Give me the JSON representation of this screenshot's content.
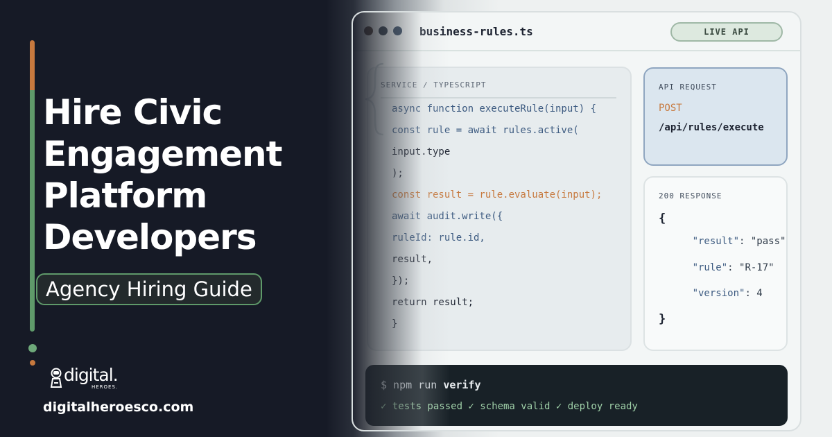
{
  "hero": {
    "title_lines": [
      "Hire Civic",
      "Engagement",
      "Platform",
      "Developers"
    ],
    "subtitle": "Agency Hiring Guide"
  },
  "brand": {
    "logo_word": "digital.",
    "logo_sub": "HEROES.",
    "url": "digitalheroesco.com"
  },
  "editor": {
    "filename": "business-rules.ts",
    "live_badge": "LIVE API",
    "code_header": "SERVICE / TYPESCRIPT",
    "code_lines": [
      {
        "text": "async function executeRule(input) {",
        "color": "#3c5a80"
      },
      {
        "text": "const rule = await rules.active(",
        "color": "#3c5a80"
      },
      {
        "text": "input.type",
        "color": "#1c2230"
      },
      {
        "text": ");",
        "color": "#1c2230"
      },
      {
        "text": "const result = rule.evaluate(input);",
        "color": "#c7793e"
      },
      {
        "text": "await audit.write({",
        "color": "#3c5a80"
      },
      {
        "text": "ruleId: rule.id,",
        "color": "#3c5a80"
      },
      {
        "text": "result,",
        "color": "#1c2230"
      },
      {
        "text": "});",
        "color": "#1c2230"
      },
      {
        "text": "return result;",
        "color": "#1c2230"
      },
      {
        "text": "}",
        "color": "#1c2230"
      }
    ],
    "request": {
      "label": "API REQUEST",
      "method": "POST",
      "path": "/api/rules/execute"
    },
    "response": {
      "label": "200 RESPONSE",
      "open_brace": "{",
      "close_brace": "}",
      "fields": [
        {
          "key": "\"result\"",
          "value": ": \"pass\""
        },
        {
          "key": "\"rule\"",
          "value": ": \"R-17\""
        },
        {
          "key": "\"version\"",
          "value": ": 4"
        }
      ]
    },
    "terminal": {
      "prompt": "$ npm run ",
      "command": "verify",
      "output": "✓ tests passed ✓ schema valid ✓ deploy ready"
    }
  },
  "colors": {
    "background": "#161a26",
    "accent_orange": "#c7793e",
    "accent_green": "#5f9a6a",
    "code_blue": "#3c5a80",
    "terminal_bg": "#182127",
    "terminal_green": "#9fd0a8"
  },
  "icons": [
    "window-dot-icon",
    "brace-decoration-icon",
    "astronaut-logo-icon"
  ]
}
